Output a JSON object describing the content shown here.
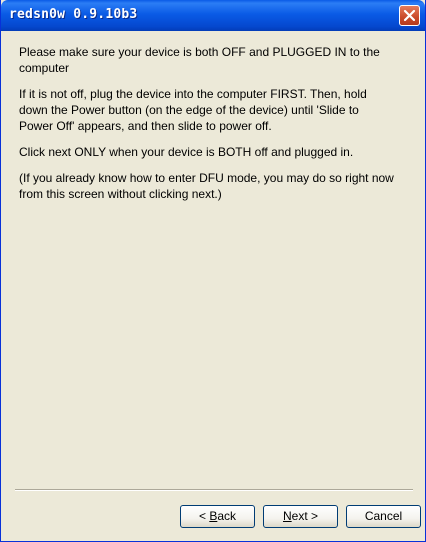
{
  "window": {
    "title": "redsn0w 0.9.10b3"
  },
  "instructions": [
    "Please make sure your device is both OFF and PLUGGED IN to the computer",
    "If it is not off, plug the device into the computer FIRST. Then, hold down the Power button (on the edge of the device) until 'Slide to Power Off' appears, and then slide to power off.",
    "Click next ONLY when your device is BOTH off and plugged in.",
    "(If you already know how to enter DFU mode, you may do so right now from this screen without clicking next.)"
  ],
  "buttons": {
    "back_prefix": "< ",
    "back_accel": "B",
    "back_rest": "ack",
    "next_accel": "N",
    "next_rest": "ext >",
    "cancel": "Cancel"
  },
  "colors": {
    "titlebar": "#0a5be6",
    "window_bg": "#ece9d8",
    "close_button": "#c94a2a"
  },
  "icons": {
    "close": "close-icon"
  }
}
